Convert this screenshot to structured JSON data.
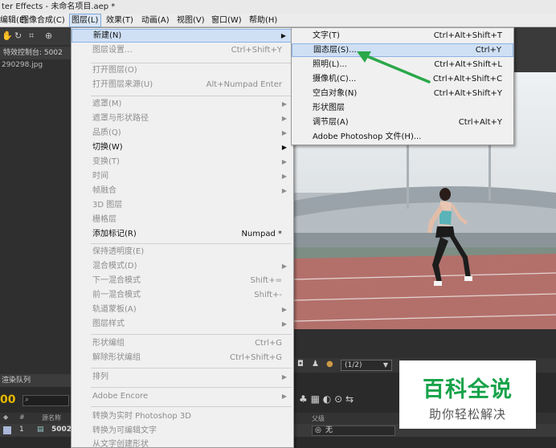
{
  "window": {
    "title": "ter Effects - 未命名项目.aep *"
  },
  "menubar": {
    "items": [
      "编辑(E)",
      "图像合成(C)",
      "图层(L)",
      "效果(T)",
      "动画(A)",
      "视图(V)",
      "窗口(W)",
      "帮助(H)"
    ],
    "active_index": 2
  },
  "left_panel": {
    "tab_label": "特效控制台: 5002",
    "file_name": "290298.jpg"
  },
  "layer_menu": {
    "items": [
      {
        "label": "新建(N)",
        "shortcut": "",
        "submenu": true,
        "enabled": true,
        "highlighted": true
      },
      {
        "label": "图层设置...",
        "shortcut": "Ctrl+Shift+Y",
        "submenu": false,
        "enabled": false
      },
      {
        "label": "打开图层(O)",
        "shortcut": "",
        "submenu": false,
        "enabled": false
      },
      {
        "label": "打开图层来源(U)",
        "shortcut": "Alt+Numpad Enter",
        "submenu": false,
        "enabled": false
      },
      {
        "label": "遮罩(M)",
        "shortcut": "",
        "submenu": true,
        "enabled": false
      },
      {
        "label": "遮罩与形状路径",
        "shortcut": "",
        "submenu": true,
        "enabled": false
      },
      {
        "label": "品质(Q)",
        "shortcut": "",
        "submenu": true,
        "enabled": false
      },
      {
        "label": "切换(W)",
        "shortcut": "",
        "submenu": true,
        "enabled": true
      },
      {
        "label": "变换(T)",
        "shortcut": "",
        "submenu": true,
        "enabled": false
      },
      {
        "label": "时间",
        "shortcut": "",
        "submenu": true,
        "enabled": false
      },
      {
        "label": "帧融合",
        "shortcut": "",
        "submenu": true,
        "enabled": false
      },
      {
        "label": "3D 图层",
        "shortcut": "",
        "submenu": false,
        "enabled": false
      },
      {
        "label": "栅格层",
        "shortcut": "",
        "submenu": false,
        "enabled": false
      },
      {
        "label": "添加标记(R)",
        "shortcut": "Numpad *",
        "submenu": false,
        "enabled": true
      },
      {
        "label": "保持透明度(E)",
        "shortcut": "",
        "submenu": false,
        "enabled": false
      },
      {
        "label": "混合模式(D)",
        "shortcut": "",
        "submenu": true,
        "enabled": false
      },
      {
        "label": "下一混合模式",
        "shortcut": "Shift+=",
        "submenu": false,
        "enabled": false
      },
      {
        "label": "前一混合模式",
        "shortcut": "Shift+-",
        "submenu": false,
        "enabled": false
      },
      {
        "label": "轨道蒙板(A)",
        "shortcut": "",
        "submenu": true,
        "enabled": false
      },
      {
        "label": "图层样式",
        "shortcut": "",
        "submenu": true,
        "enabled": false
      },
      {
        "label": "形状编组",
        "shortcut": "Ctrl+G",
        "submenu": false,
        "enabled": false
      },
      {
        "label": "解除形状编组",
        "shortcut": "Ctrl+Shift+G",
        "submenu": false,
        "enabled": false
      },
      {
        "label": "排列",
        "shortcut": "",
        "submenu": true,
        "enabled": false
      },
      {
        "label": "Adobe Encore",
        "shortcut": "",
        "submenu": true,
        "enabled": false
      },
      {
        "label": "转换为实时 Photoshop 3D",
        "shortcut": "",
        "submenu": false,
        "enabled": false
      },
      {
        "label": "转换为可编辑文字",
        "shortcut": "",
        "submenu": false,
        "enabled": false
      },
      {
        "label": "从文字创建形状",
        "shortcut": "",
        "submenu": false,
        "enabled": false
      }
    ]
  },
  "new_submenu": {
    "items": [
      {
        "label": "文字(T)",
        "shortcut": "Ctrl+Alt+Shift+T",
        "highlighted": false
      },
      {
        "label": "固态层(S)...",
        "shortcut": "Ctrl+Y",
        "highlighted": true
      },
      {
        "label": "照明(L)...",
        "shortcut": "Ctrl+Alt+Shift+L",
        "highlighted": false
      },
      {
        "label": "摄像机(C)...",
        "shortcut": "Ctrl+Alt+Shift+C",
        "highlighted": false
      },
      {
        "label": "空白对象(N)",
        "shortcut": "Ctrl+Alt+Shift+Y",
        "highlighted": false
      },
      {
        "label": "形状图层",
        "shortcut": "",
        "highlighted": false
      },
      {
        "label": "调节层(A)",
        "shortcut": "Ctrl+Alt+Y",
        "highlighted": false
      },
      {
        "label": "Adobe Photoshop 文件(H)...",
        "shortcut": "",
        "highlighted": false
      }
    ]
  },
  "viewer": {
    "zoom_label": "(1/2)"
  },
  "timeline": {
    "tab_label": "渲染队列",
    "timecode": "00",
    "col_source": "源名称",
    "col_parent": "父级",
    "row": {
      "num": "1",
      "name": "5002"
    },
    "parent_value": "无"
  },
  "watermark": {
    "title": "百科全说",
    "subtitle": "助你轻松解决"
  },
  "colors": {
    "accent_green": "#17a34a",
    "timecode_yellow": "#e6b800",
    "menu_highlight": "#cfe0f5"
  }
}
